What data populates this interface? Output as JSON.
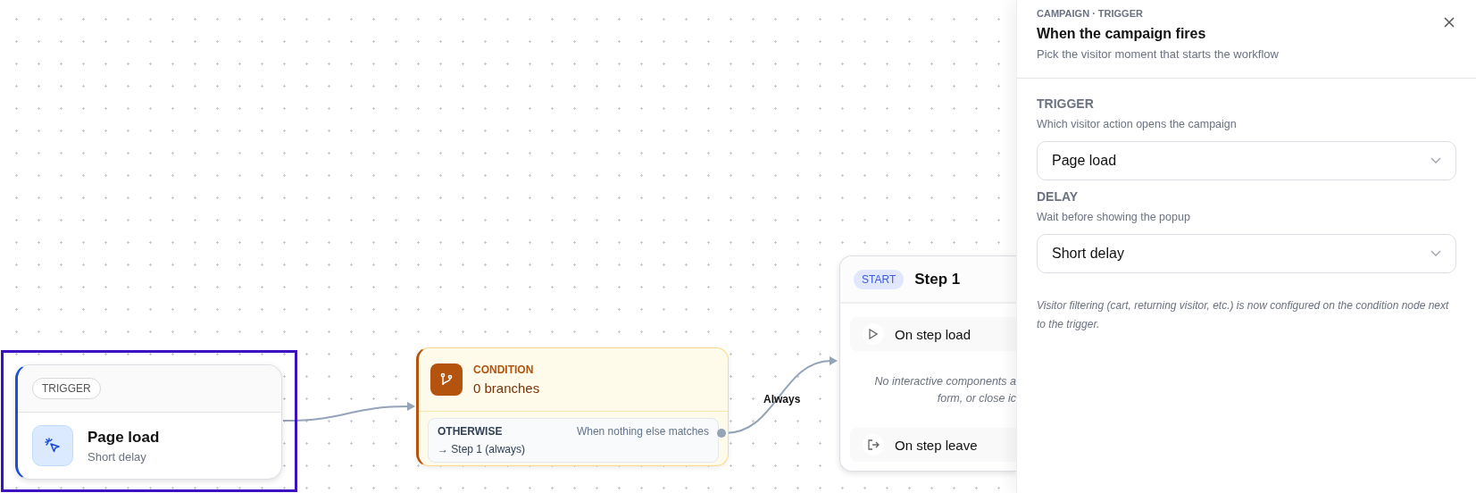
{
  "canvas": {
    "trigger_node": {
      "badge": "TRIGGER",
      "title": "Page load",
      "subtitle": "Short delay",
      "selected": true
    },
    "condition_node": {
      "label": "CONDITION",
      "title": "0 branches",
      "branches": [
        {
          "label": "OTHERWISE",
          "description": "When nothing else matches",
          "target": "→ Step 1 (always)"
        }
      ]
    },
    "edge_label": "Always",
    "step_node": {
      "badge": "START",
      "title": "Step 1",
      "items": [
        {
          "kind": "load",
          "label": "On step load"
        },
        {
          "kind": "note",
          "lines": [
            "No interactive components a",
            "form, or close ic"
          ]
        },
        {
          "kind": "leave",
          "label": "On step leave"
        }
      ]
    }
  },
  "panel": {
    "eyebrow": "CAMPAIGN · TRIGGER",
    "title": "When the campaign fires",
    "subtitle": "Pick the visitor moment that starts the workflow",
    "fields": [
      {
        "label": "TRIGGER",
        "help": "Which visitor action opens the campaign",
        "value": "Page load"
      },
      {
        "label": "DELAY",
        "help": "Wait before showing the popup",
        "value": "Short delay"
      }
    ],
    "note": "Visitor filtering (cart, returning visitor, etc.) is now configured on the condition node next to the trigger."
  }
}
